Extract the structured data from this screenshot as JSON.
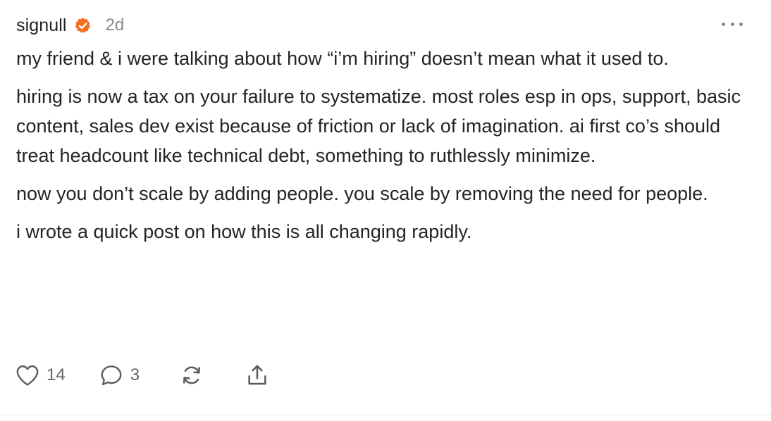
{
  "post": {
    "author": "signull",
    "timestamp": "2d",
    "paragraphs": [
      "my friend & i were talking about how “i’m hiring” doesn’t mean what it used to.",
      "hiring is now a tax on your failure to systematize. most roles esp in ops, support, basic content, sales dev exist because of friction or lack of imagination. ai first co’s should treat headcount like technical debt, something to ruthlessly minimize.",
      "now you don’t scale by adding people. you scale by removing the need for people.",
      "i wrote a quick post on how this is all changing rapidly."
    ],
    "actions": {
      "likes": "14",
      "comments": "3"
    }
  },
  "icons": {
    "badge": "verified-badge-icon",
    "more": "more-horizontal-icon",
    "like": "heart-icon",
    "comment": "comment-bubble-icon",
    "restack": "restack-icon",
    "share": "share-icon"
  },
  "colors": {
    "badge": "#f07020",
    "text": "#242424",
    "muted": "#8a8a8a"
  }
}
